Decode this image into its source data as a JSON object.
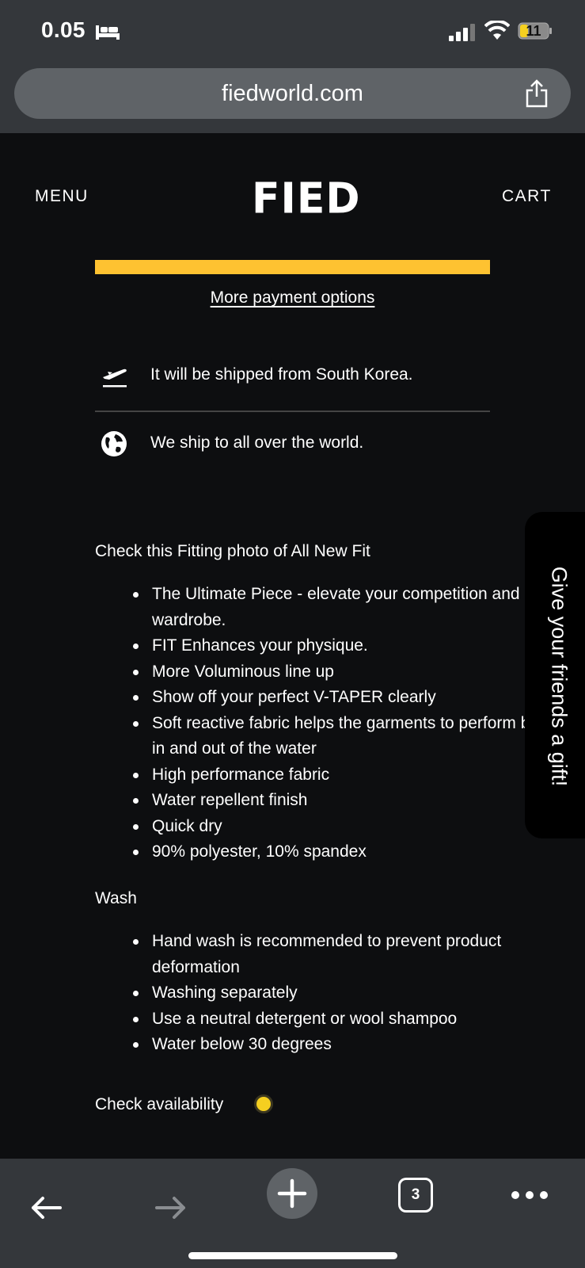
{
  "status_bar": {
    "time": "0.05",
    "battery": "11"
  },
  "browser": {
    "url": "fiedworld.com",
    "open_tabs": "3"
  },
  "header": {
    "menu_label": "MENU",
    "logo": "FIED",
    "cart_label": "CART"
  },
  "payment": {
    "bar_color": "#fec231",
    "more_options": "More payment options"
  },
  "shipping": {
    "from": "It will be shipped from South Korea.",
    "world": "We ship to all over the world."
  },
  "fit": {
    "heading": "Check this Fitting photo of All New Fit",
    "features": [
      "The Ultimate Piece - elevate your competition and swim wardrobe.",
      "FIT Enhances your physique.",
      "More Voluminous line up",
      "Show off your perfect V-TAPER clearly",
      "Soft reactive fabric helps the garments to perform both in and out of the water",
      "High performance fabric",
      "Water repellent finish",
      "Quick dry",
      "90% polyester, 10% spandex"
    ]
  },
  "wash": {
    "heading": "Wash",
    "items": [
      "Hand wash is recommended to prevent product deformation",
      "Washing separately",
      "Use a neutral detergent or wool shampoo",
      "Water below 30 degrees"
    ]
  },
  "availability": {
    "label": "Check availability",
    "dot_color": "#f5cf20"
  },
  "side_tab": {
    "label": "Give your friends a gift!"
  },
  "icons": {
    "status": [
      "bed-icon",
      "signal-icon",
      "wifi-icon",
      "battery-icon"
    ],
    "shipping": [
      "airplane-departure-icon",
      "globe-icon"
    ],
    "toolbar": [
      "back-arrow-icon",
      "forward-arrow-icon",
      "plus-icon",
      "tabs-icon",
      "more-dots-icon"
    ]
  }
}
